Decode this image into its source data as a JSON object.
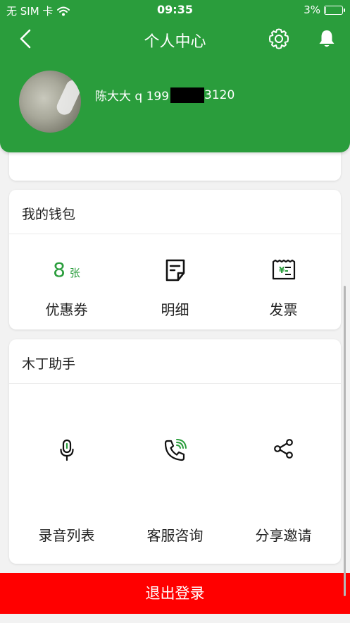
{
  "status_bar": {
    "carrier": "无 SIM 卡",
    "time": "09:35",
    "battery": "3%",
    "battery_level": 0.03
  },
  "nav": {
    "title": "个人中心",
    "back_icon": "chevron-left-icon",
    "settings_icon": "gear-icon",
    "notification_icon": "bell-icon"
  },
  "profile": {
    "name_prefix": "陈大大 q 199",
    "phone_suffix": "3120"
  },
  "wallet": {
    "title": "我的钱包",
    "items": [
      {
        "count": "8",
        "unit": "张",
        "label": "优惠券"
      },
      {
        "icon": "document-icon",
        "label": "明细"
      },
      {
        "icon": "invoice-icon",
        "label": "发票"
      }
    ]
  },
  "assistant": {
    "title": "木丁助手",
    "items": [
      {
        "icon": "microphone-icon",
        "label": "录音列表"
      },
      {
        "icon": "phone-call-icon",
        "label": "客服咨询"
      },
      {
        "icon": "share-icon",
        "label": "分享邀请"
      }
    ]
  },
  "logout_label": "退出登录",
  "colors": {
    "brand_green": "#2a9d3c",
    "logout_red": "#ff0000"
  }
}
